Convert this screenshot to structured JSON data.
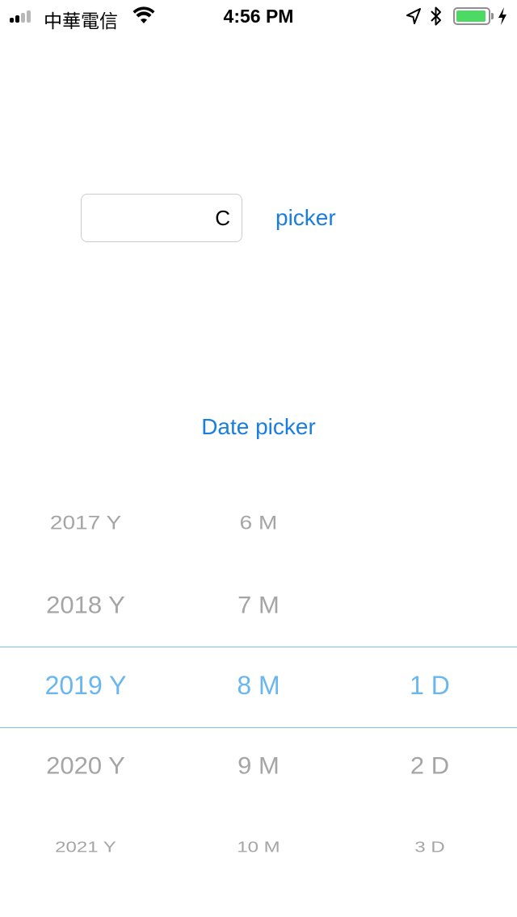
{
  "status_bar": {
    "carrier": "中華電信",
    "time": "4:56 PM",
    "battery_level": 0.95,
    "colors": {
      "battery": "#4cd964"
    },
    "icons": [
      "signal-icon",
      "wifi-icon",
      "location-arrow-icon",
      "bluetooth-icon",
      "battery-icon",
      "charging-icon"
    ]
  },
  "input": {
    "value": "C"
  },
  "buttons": {
    "picker_label": "picker",
    "date_picker_label": "Date picker"
  },
  "date_wheel": {
    "years": [
      "2017 Y",
      "2018 Y",
      "2019 Y",
      "2020 Y",
      "2021 Y"
    ],
    "months": [
      "6 M",
      "7 M",
      "8 M",
      "9 M",
      "10 M"
    ],
    "days": [
      "",
      "",
      "1 D",
      "2 D",
      "3 D"
    ],
    "selected": {
      "year": "2019 Y",
      "month": "8 M",
      "day": "1 D"
    }
  },
  "colors": {
    "accent": "#1a7ee0",
    "selection": "#6ab6ef",
    "separator": "#7cc0ee",
    "inactive_text": "#a5a5a5"
  }
}
